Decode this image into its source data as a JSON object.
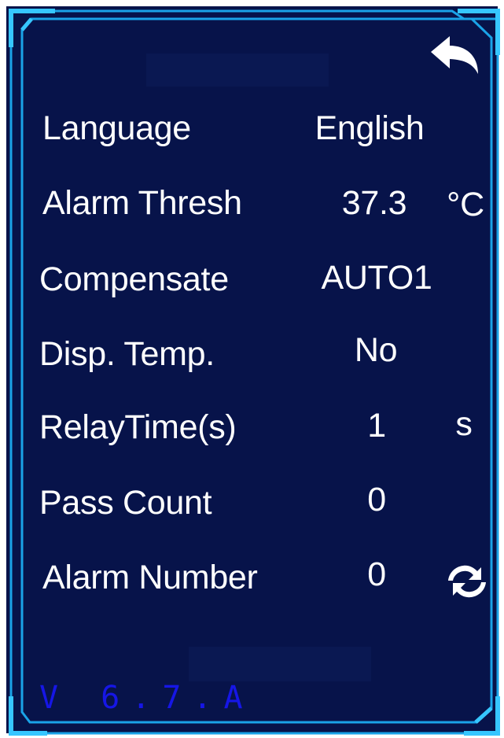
{
  "settings": [
    {
      "label": "Language",
      "value": "English",
      "unit": ""
    },
    {
      "label": "Alarm Thresh",
      "value": "37.3",
      "unit": "°C"
    },
    {
      "label": "Compensate",
      "value": "AUTO1",
      "unit": ""
    },
    {
      "label": "Disp. Temp.",
      "value": "No",
      "unit": ""
    },
    {
      "label": "RelayTime(s)",
      "value": "1",
      "unit": "s"
    },
    {
      "label": "Pass Count",
      "value": "0",
      "unit": ""
    },
    {
      "label": "Alarm Number",
      "value": "0",
      "unit": ""
    }
  ],
  "version": "V 6.7.A",
  "icons": {
    "back": "back-arrow-icon",
    "refresh": "refresh-icon"
  },
  "colors": {
    "background": "#07134a",
    "frame": "#1aa3e8",
    "text": "#ffffff",
    "version": "#1616e6"
  }
}
